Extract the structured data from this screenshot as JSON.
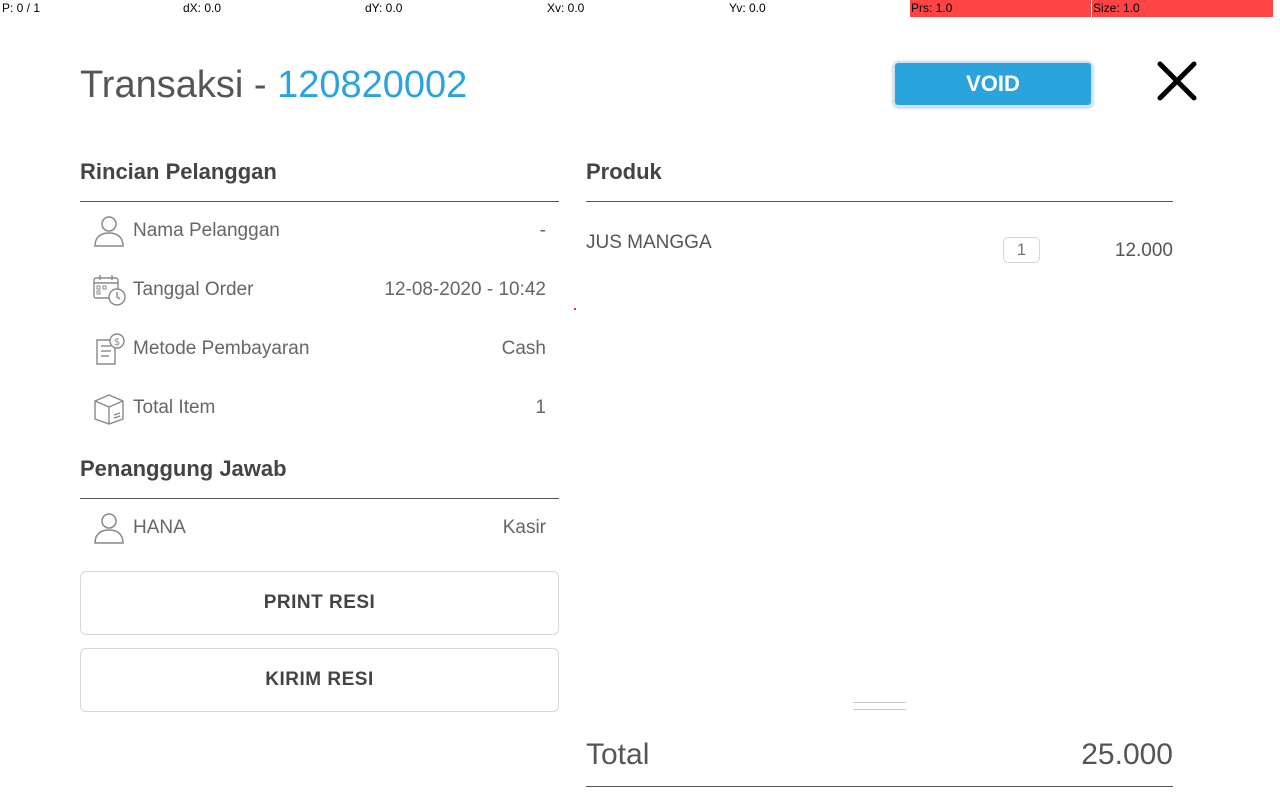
{
  "debug": {
    "pointers": "P: 0 / 1",
    "dx": "dX: 0.0",
    "dy": "dY: 0.0",
    "xv": "Xv: 0.0",
    "yv": "Yv: 0.0",
    "prs": "Prs: 1.0",
    "size": "Size: 1.0"
  },
  "header": {
    "title_prefix": "Transaksi - ",
    "transaction_id": "120820002",
    "void_label": "VOID"
  },
  "customer": {
    "section_title": "Rincian Pelanggan",
    "rows": [
      {
        "icon": "user-icon",
        "label": "Nama Pelanggan",
        "value": "-"
      },
      {
        "icon": "calendar-clock-icon",
        "label": "Tanggal Order",
        "value": "12-08-2020 - 10:42"
      },
      {
        "icon": "receipt-dollar-icon",
        "label": "Metode Pembayaran",
        "value": "Cash"
      },
      {
        "icon": "box-icon",
        "label": "Total Item",
        "value": "1"
      }
    ]
  },
  "responsible": {
    "section_title": "Penanggung Jawab",
    "name": "HANA",
    "role": "Kasir"
  },
  "actions": {
    "print_label": "PRINT RESI",
    "send_label": "KIRIM RESI"
  },
  "products": {
    "section_title": "Produk",
    "items": [
      {
        "name": "JUS MANGGA",
        "qty": "1",
        "price": "12.000"
      }
    ]
  },
  "total": {
    "label": "Total",
    "value": "25.000"
  },
  "colors": {
    "accent": "#2ba4dd",
    "debug_red": "#ff4444"
  }
}
